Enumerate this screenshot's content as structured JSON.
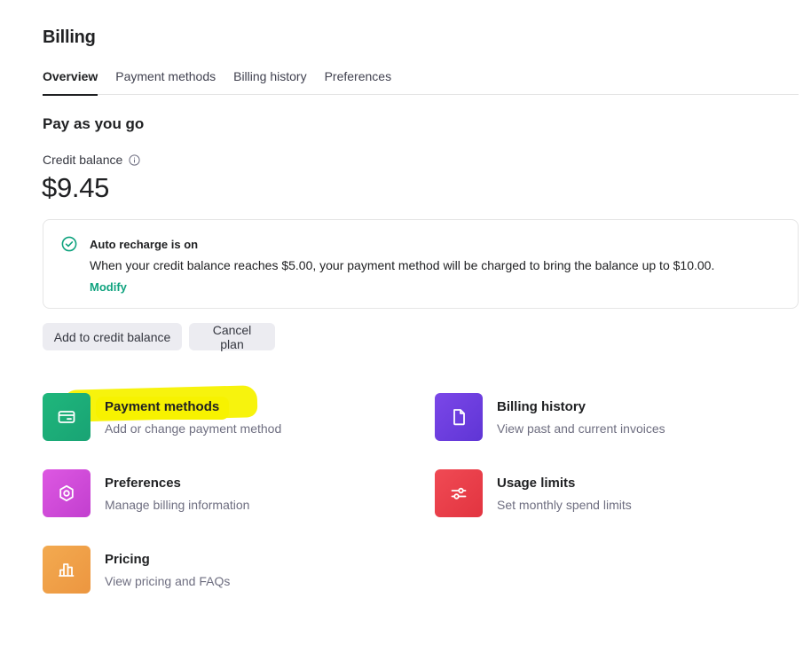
{
  "page": {
    "title": "Billing"
  },
  "tabs": [
    {
      "label": "Overview",
      "active": true
    },
    {
      "label": "Payment methods",
      "active": false
    },
    {
      "label": "Billing history",
      "active": false
    },
    {
      "label": "Preferences",
      "active": false
    }
  ],
  "plan": {
    "title": "Pay as you go",
    "credit_label": "Credit balance",
    "balance": "$9.45"
  },
  "recharge": {
    "title": "Auto recharge is on",
    "description": "When your credit balance reaches $5.00, your payment method will be charged to bring the balance up to $10.00.",
    "modify_label": "Modify"
  },
  "actions": {
    "add_credit": "Add to credit balance",
    "cancel_plan": "Cancel plan"
  },
  "tiles": {
    "payment": {
      "title": "Payment methods",
      "subtitle": "Add or change payment method",
      "icon": "credit-card-icon"
    },
    "history": {
      "title": "Billing history",
      "subtitle": "View past and current invoices",
      "icon": "document-icon"
    },
    "preferences": {
      "title": "Preferences",
      "subtitle": "Manage billing information",
      "icon": "gear-icon"
    },
    "limits": {
      "title": "Usage limits",
      "subtitle": "Set monthly spend limits",
      "icon": "sliders-icon"
    },
    "pricing": {
      "title": "Pricing",
      "subtitle": "View pricing and FAQs",
      "icon": "bar-chart-icon"
    }
  },
  "colors": {
    "accent": "#10a37f",
    "highlight": "#f7f200",
    "tile_green": "#19c37d",
    "tile_purple": "#6e3fe0",
    "tile_pink": "#d64fdb",
    "tile_red": "#ef4146",
    "tile_orange": "#f0a04a"
  }
}
